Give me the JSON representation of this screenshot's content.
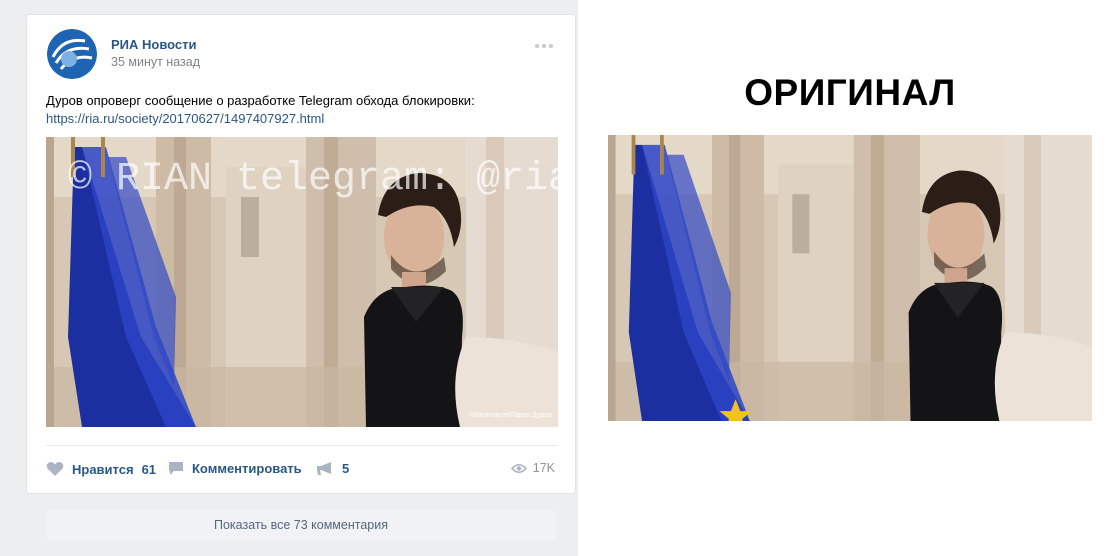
{
  "post": {
    "author": "РИА Новости",
    "time": "35 минут назад",
    "text": "Дуров опроверг сообщение о разработке Telegram обхода блокировки:",
    "link": "https://ria.ru/society/20170627/1497407927.html",
    "photo": {
      "watermark": "© RIAN telegram: @rianovosti",
      "credit": "©ВКонтакте/Павел Дуров"
    },
    "actions": {
      "like_label": "Нравится",
      "like_count": "61",
      "comment_label": "Комментировать",
      "share_count": "5",
      "views": "17K"
    },
    "show_comments": "Показать все 73 комментария"
  },
  "original": {
    "title": "ОРИГИНАЛ"
  },
  "colors": {
    "link": "#2a5885",
    "feed_background": "#edeef0",
    "flag_blue": "#1c2fa0",
    "muted": "#939393"
  },
  "icons": [
    "more-dots-icon",
    "heart-icon",
    "comment-icon",
    "megaphone-icon",
    "eye-icon"
  ]
}
